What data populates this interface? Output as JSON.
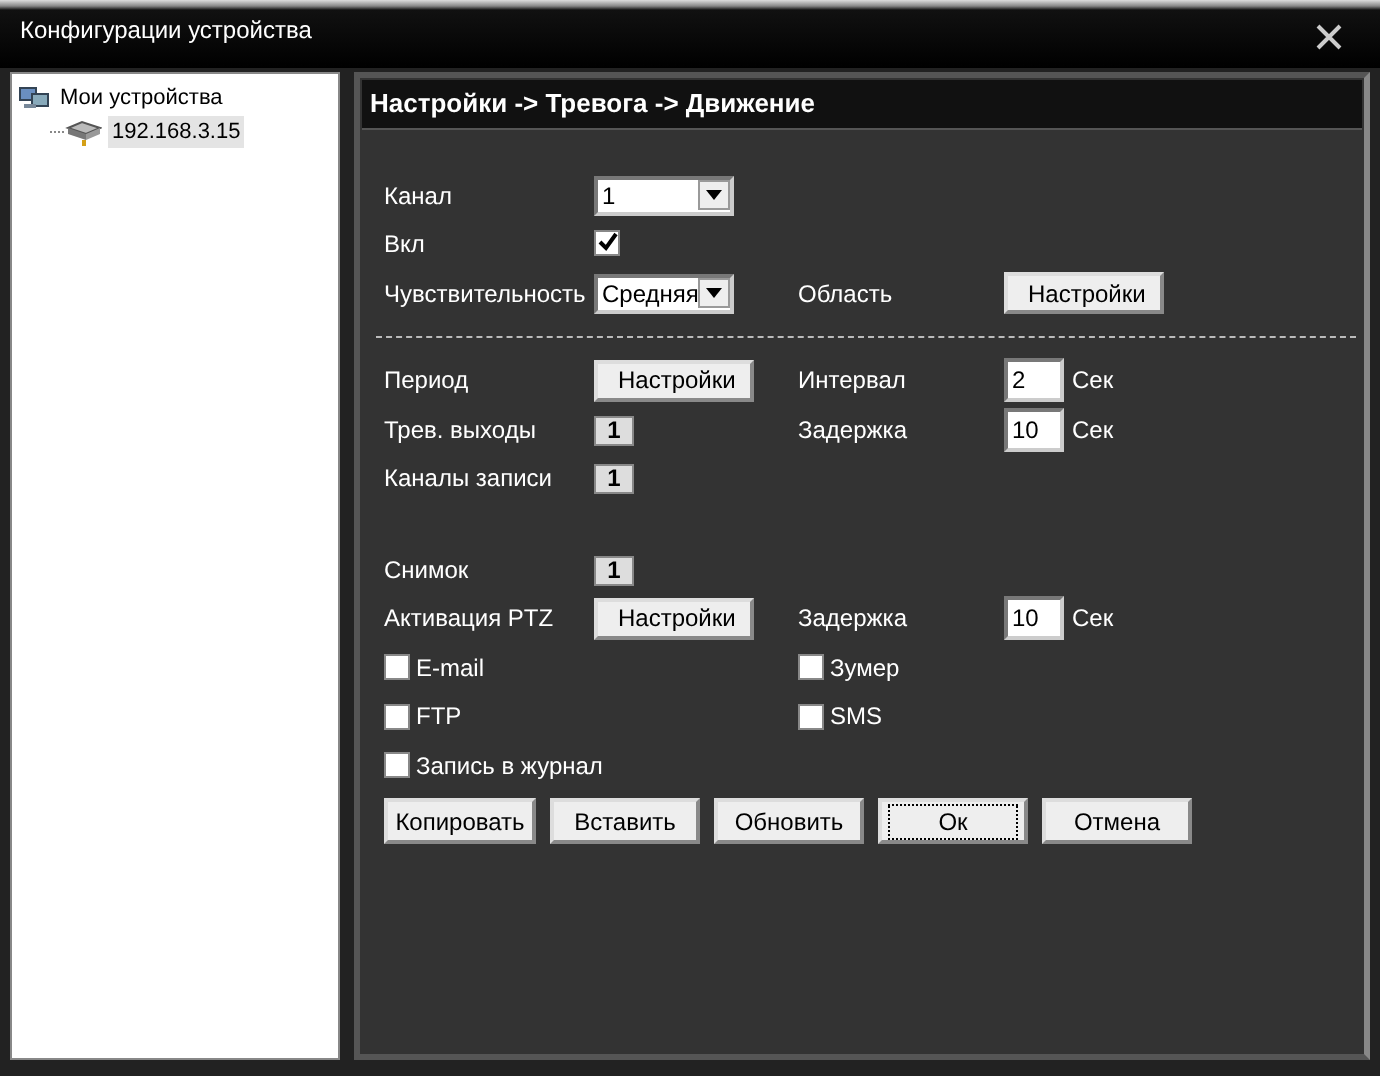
{
  "window": {
    "title": "Конфигурации устройства"
  },
  "tree": [
    {
      "label": "Мои устройства",
      "selected": false,
      "children": [
        {
          "label": "192.168.3.15",
          "selected": true
        }
      ]
    }
  ],
  "panel": {
    "title": "Настройки -> Тревога -> Движение"
  },
  "rows": [
    {
      "kind": "fields",
      "cells": [
        {
          "kind": "label",
          "text": "Канал"
        },
        {
          "kind": "select",
          "value": "1"
        }
      ]
    },
    {
      "kind": "fields",
      "cells": [
        {
          "kind": "label",
          "text": "Вкл"
        },
        {
          "kind": "checkbox",
          "checked": true
        }
      ]
    },
    {
      "kind": "fields",
      "cells": [
        {
          "kind": "label",
          "text": "Чувствительность"
        },
        {
          "kind": "select",
          "value": "Средняя"
        },
        {
          "kind": "label",
          "text": "Область"
        },
        {
          "kind": "button",
          "text": "Настройки"
        }
      ]
    },
    {
      "kind": "divider"
    },
    {
      "kind": "fields",
      "cells": [
        {
          "kind": "label",
          "text": "Период"
        },
        {
          "kind": "button",
          "text": "Настройки"
        },
        {
          "kind": "label",
          "text": "Интервал"
        },
        {
          "kind": "input",
          "value": "2"
        },
        {
          "kind": "unit",
          "text": "Сек"
        }
      ]
    },
    {
      "kind": "fields",
      "cells": [
        {
          "kind": "label",
          "text": "Трев. выходы"
        },
        {
          "kind": "toggle",
          "text": "1"
        },
        {
          "kind": "label",
          "text": "Задержка"
        },
        {
          "kind": "input",
          "value": "10"
        },
        {
          "kind": "unit",
          "text": "Сек"
        }
      ]
    },
    {
      "kind": "fields",
      "cells": [
        {
          "kind": "label",
          "text": "Каналы записи"
        },
        {
          "kind": "toggle",
          "text": "1"
        }
      ]
    },
    {
      "kind": "spacer"
    },
    {
      "kind": "fields",
      "cells": [
        {
          "kind": "label",
          "text": "Снимок"
        },
        {
          "kind": "toggle",
          "text": "1"
        }
      ]
    },
    {
      "kind": "fields",
      "cells": [
        {
          "kind": "label",
          "text": "Активация PTZ"
        },
        {
          "kind": "button",
          "text": "Настройки"
        },
        {
          "kind": "label",
          "text": "Задержка"
        },
        {
          "kind": "input",
          "value": "10"
        },
        {
          "kind": "unit",
          "text": "Сек"
        }
      ]
    },
    {
      "kind": "fields",
      "cells": [
        {
          "kind": "check",
          "text": "E-mail",
          "checked": false
        },
        {
          "kind": "check",
          "text": "Зумер",
          "checked": false
        }
      ]
    },
    {
      "kind": "fields",
      "cells": [
        {
          "kind": "check",
          "text": "FTP",
          "checked": false
        },
        {
          "kind": "check",
          "text": "SMS",
          "checked": false
        }
      ]
    },
    {
      "kind": "fields",
      "cells": [
        {
          "kind": "check",
          "text": "Запись в журнал",
          "checked": false
        }
      ]
    }
  ],
  "buttons": [
    {
      "label": "Копировать",
      "focused": false
    },
    {
      "label": "Вставить",
      "focused": false
    },
    {
      "label": "Обновить",
      "focused": false
    },
    {
      "label": "Ок",
      "focused": true
    },
    {
      "label": "Отмена",
      "focused": false
    }
  ]
}
